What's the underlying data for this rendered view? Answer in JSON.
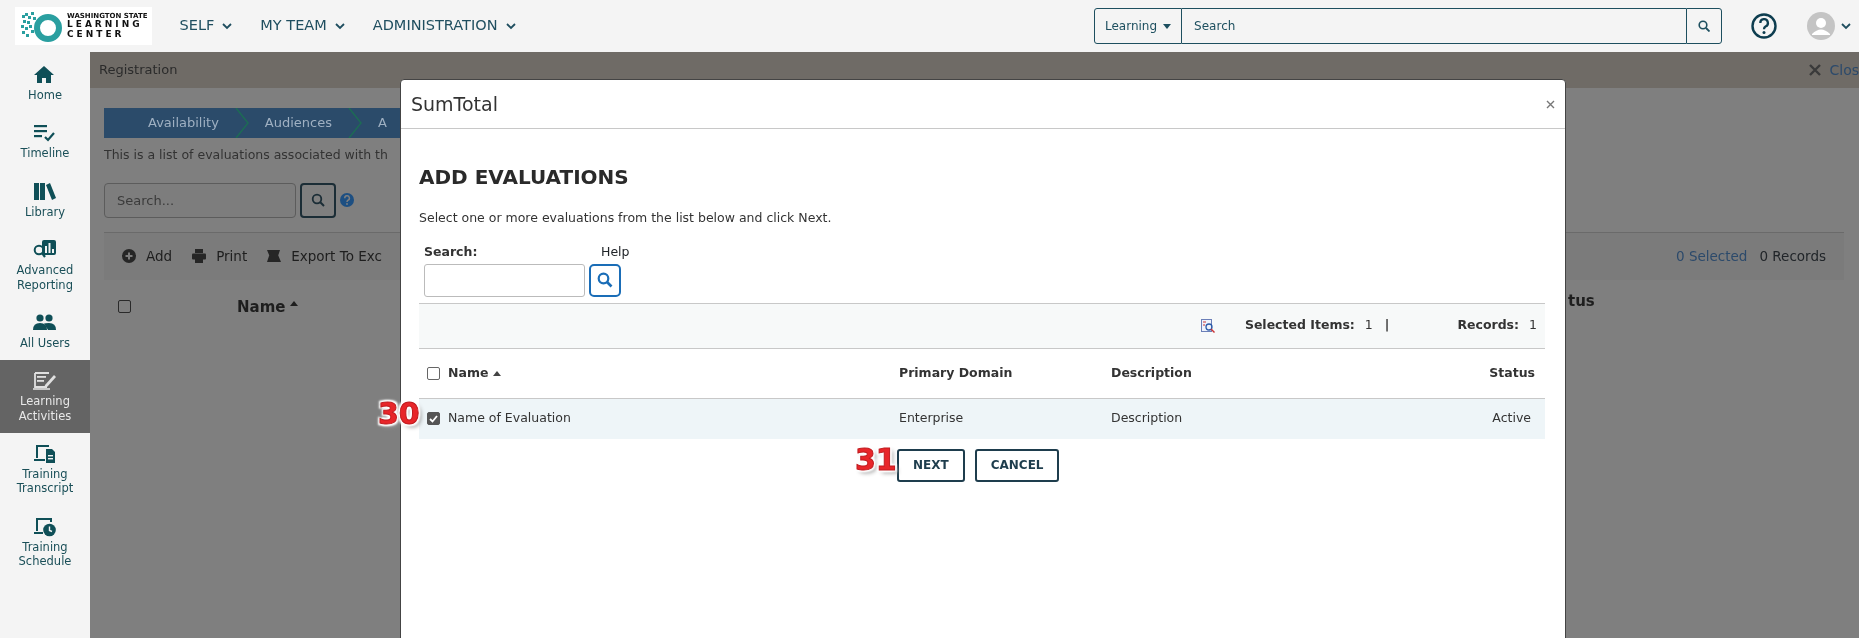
{
  "header": {
    "logo": {
      "lines": [
        "WASHINGTON STATE",
        "LEARNING",
        "CENTER"
      ]
    },
    "nav": [
      {
        "label": "SELF"
      },
      {
        "label": "MY TEAM"
      },
      {
        "label": "ADMINISTRATION"
      }
    ],
    "search": {
      "scope": "Learning",
      "placeholder": "Search"
    }
  },
  "sidebar": {
    "items": [
      {
        "label": "Home",
        "kind": "home",
        "selected": false
      },
      {
        "label": "Timeline",
        "kind": "timeline",
        "selected": false
      },
      {
        "label": "Library",
        "kind": "library",
        "selected": false
      },
      {
        "label": "Advanced Reporting",
        "kind": "reporting",
        "selected": false
      },
      {
        "label": "All Users",
        "kind": "users",
        "selected": false
      },
      {
        "label": "Learning Activities",
        "kind": "activities",
        "selected": true
      },
      {
        "label": "Training Transcript",
        "kind": "transcript",
        "selected": false
      },
      {
        "label": "Training Schedule",
        "kind": "schedule",
        "selected": false
      }
    ]
  },
  "page": {
    "title": "Registration",
    "close": "Clos",
    "steps": [
      "Availability",
      "Audiences",
      "A"
    ],
    "intro": "This is a list of evaluations associated with th",
    "search_placeholder": "Search...",
    "toolbar": [
      {
        "label": "Add",
        "kind": "add"
      },
      {
        "label": "Print",
        "kind": "print"
      },
      {
        "label": "Export To Exc",
        "kind": "excel"
      }
    ],
    "selected_count": "0 Selected",
    "records": "0 Records",
    "select_all": {
      "checked": false
    },
    "columns": [
      "Name",
      "tus"
    ]
  },
  "modal": {
    "title": "SumTotal",
    "heading": "ADD EVALUATIONS",
    "instructions": "Select one or more evaluations from the list below and click Next.",
    "search_label": "Search:",
    "help": "Help",
    "selected_label": "Selected Items:",
    "selected_value": "1",
    "separator": "|",
    "records_label": "Records:",
    "records_value": "1",
    "table": {
      "select_all": {
        "checked": false
      },
      "columns": [
        "Name",
        "Primary Domain",
        "Description",
        "Status"
      ],
      "rows": [
        {
          "checked": true,
          "selected": true,
          "cells": [
            "Name of Evaluation",
            "Enterprise",
            "Description",
            "Active"
          ]
        }
      ]
    },
    "buttons": [
      "NEXT",
      "CANCEL"
    ]
  },
  "annotations": [
    {
      "label": "30",
      "kind": "row"
    },
    {
      "label": "31",
      "kind": "button"
    }
  ]
}
